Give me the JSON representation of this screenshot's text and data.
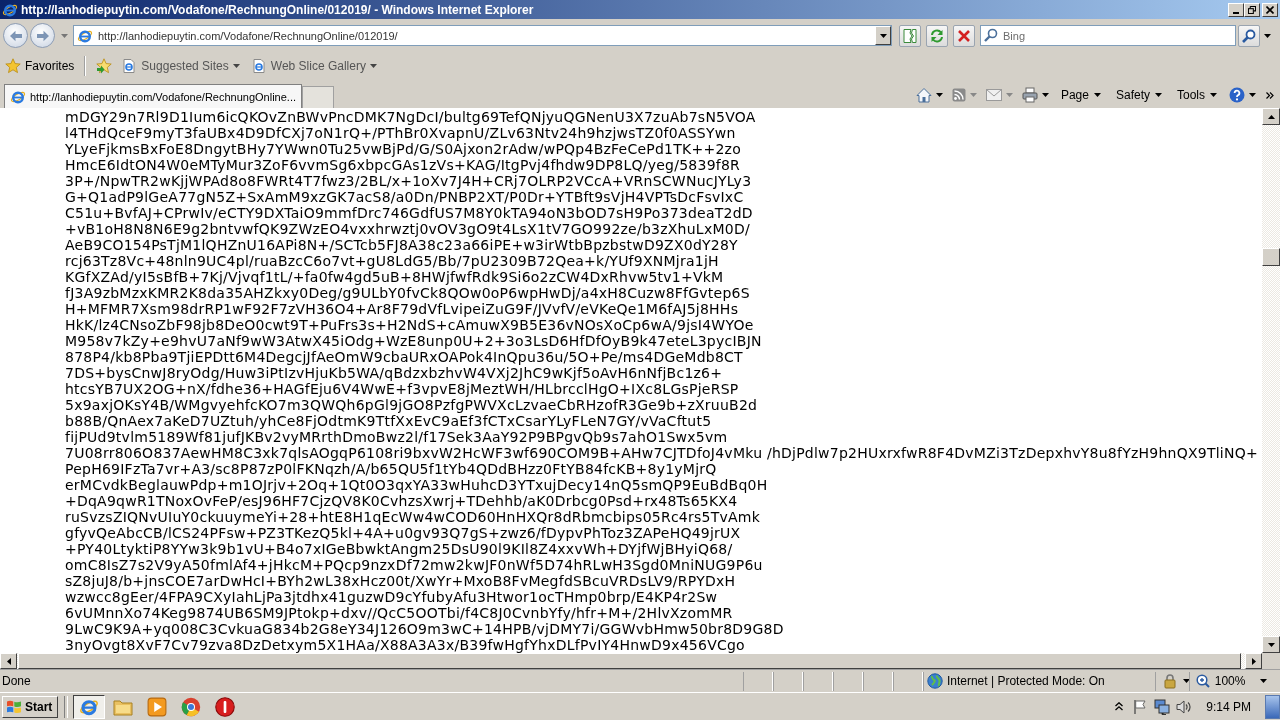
{
  "window": {
    "title": "http://lanhodiepuytin.com/Vodafone/RechnungOnline/012019/ - Windows Internet Explorer"
  },
  "address_bar": {
    "url": "http://lanhodiepuytin.com/Vodafone/RechnungOnline/012019/"
  },
  "search": {
    "placeholder": "Bing"
  },
  "favorites_bar": {
    "label": "Favorites",
    "items": [
      {
        "label": "Suggested Sites"
      },
      {
        "label": "Web Slice Gallery"
      }
    ]
  },
  "tabs": [
    {
      "label": "http://lanhodiepuytin.com/Vodafone/RechnungOnline...",
      "selected": true
    }
  ],
  "command_bar": {
    "menus": [
      {
        "label": "Page"
      },
      {
        "label": "Safety"
      },
      {
        "label": "Tools"
      }
    ]
  },
  "content": {
    "lines": [
      "mDGY29n7Rl9D1Ium6icQKOvZnBWvPncDMK7NgDcI/bultg69TefQNjyuQGNenU3X7zuAb7sN5VOA",
      "l4THdQceF9myT3faUBx4D9DfCXj7oN1rQ+/PThBr0XvapnU/ZLv63Ntv24h9hzjwsTZ0f0ASSYwn",
      "YLyeFjkmsBxFoE8DngytBHy7YWwn0Tu25vwBjPd/G/S0Ajxon2rAdw/wPQp4BzFeCePd1TK++2zo",
      "HmcE6IdtON4W0eMTyMur3ZoF6vvmSg6xbpcGAs1zVs+KAG/ItgPvj4fhdw9DP8LQ/yeg/5839f8R",
      "3P+/NpwTR2wKjjWPAd8o8FWRt4T7fwz3/2BL/x+1oXv7J4H+CRj7OLRP2VCcA+VRnSCWNucJYLy3",
      "G+Q1adP9lGeA77gN5Z+SxAmM9xzGK7acS8/a0Dn/PNBP2XT/P0Dr+YTBft9sVjH4VPTsDcFsvIxC",
      "C51u+BvfAJ+CPrwIv/eCTY9DXTaiO9mmfDrc746GdfUS7M8Y0kTA94oN3bOD7sH9Po373deaT2dD",
      "+vB1oH8N8N6E9g2bntvwfQK9ZWzEO4vxxhrwztj0vOV3gO9t4LsX1tV7GO992ze/b3zXhuLxM0D/",
      "AeB9CO154PsTjM1lQHZnU16APi8N+/SCTcb5FJ8A38c23a66iPE+w3irWtbBpzbstwD9ZX0dY28Y",
      "rcj63Tz8Vc+48nln9UC4pl/ruaBzcC6o7vt+gU8LdG5/Bb/7pU2309B72Qea+k/YUf9XNMjra1jH",
      "KGfXZAd/yI5sBfB+7Kj/Vjvqf1tL/+fa0fw4gd5uB+8HWjfwfRdk9Si6o2zCW4DxRhvw5tv1+VkM",
      "fJ3A9zbMzxKMR2K8da35AHZkxy0Deg/g9ULbY0fvCk8QOw0oP6wpHwDj/a4xH8Cuzw8FfGvtep6S",
      "H+MFMR7Xsm98drRP1wF92F7zVH36O4+Ar8F79dVfLvipeiZuG9F/JVvfV/eVKeQe1M6fAJ5j8HHs",
      "HkK/lz4CNsoZbF98jb8DeO0cwt9T+PuFrs3s+H2NdS+cAmuwX9B5E36vNOsXoCp6wA/9jsI4WYOe",
      "M958v7kZy+e9hvU7aNf9wW3AtwX45iOdg+WzE8unp0U+2+3o3LsD6HfDfOyB9k47eteL3pycIBJN",
      "878P4/kb8Pba9TjiEPDtt6M4DegcjJfAeOmW9cbaURxOAPok4InQpu36u/5O+Pe/ms4DGeMdb8CT",
      "7DS+bysCnwJ8ryOdg/Huw3iPtIzvHjuKb5WA/qBdzxbzhvW4VXj2JhC9wKjf5oAvH6nNfjBc1z6+",
      "htcsYB7UX2OG+nX/fdhe36+HAGfEju6V4WwE+f3vpvE8jMeztWH/HLbrcclHgO+IXc8LGsPjeRSP",
      "5x9axjOKsY4B/WMgvyehfcKO7m3QWQh6pGl9jGO8PzfgPWVXcLzvaeCbRHzofR3Ge9b+zXruuB2d",
      "b88B/QnAex7aKeD7UZtuh/yhCe8FjOdtmK9TtfXxEvC9aEf3fCTxCsarYLyFLeN7GY/vVaCftut5",
      "fijPUd9tvlm5189Wf81jufJKBv2vyMRrthDmoBwz2l/f17Sek3AaY92P9BPgvQb9s7ahO1Swx5vm",
      "7U08rr806O837AewHM8C3xk7qlsAOgqP6108ri9bxvW2HcWF3wf690COM9B+AHw7CJTDfoJ4vMku /hDjPdlw7p2HUxrxfwR8F4DvMZi3TzDepxhvY8u8fYzH9hnQX9TliNQ+",
      "PepH69IFzTa7vr+A3/sc8P87zP0lFKNqzh/A/b65QU5f1tYb4QDdBHzz0FtYB84fcKB+8y1yMjrQ",
      "erMCvdkBeglauwPdp+m1OJrjv+2Oq+1Qt0O3qxYA33wHuhcD3YTxujDecy14nQ5smQP9EuBdBq0H",
      "+DqA9qwR1TNoxOvFeP/esJ96HF7CjzQV8K0CvhzsXwrj+TDehhb/aK0Drbcg0Psd+rx48Ts65KX4",
      "ruSvzsZIQNvUIuY0ckuuymeYi+28+htE8H1qEcWw4wCOD60HnHXQr8dRbmcbips05Rc4rs5TvAmk",
      "gfyvQeAbcCB/lCS24PFsw+PZ3TKezQ5kl+4A+u0gv93Q7gS+zwz6/fDypvPhToz3ZAPeHQ49jrUX",
      "+PY40LtyktiP8YYw3k9b1vU+B4o7xIGeBbwktAngm25DsU90l9KIl8Z4xxvWh+DYjfWjBHyiQ68/",
      "omC8IsZ7s2V9yA50fmlAf4+jHkcM+PQcp9nzxDf72mw2kwJF0nWf5D74hRLwH3Sgd0MniNUG9P6u",
      "sZ8juJ8/b+jnsCOE7arDwHcI+BYh2wL38xHcz00t/XwYr+MxoB8FvMegfdSBcuVRDsLV9/RPYDxH",
      "wzwcc8gEer/4FPA9CXyIahLjPa3jtdhx41guzwD9cYfubyAfu3Htwor1ocTHmp0brp/E4KP4r2Sw",
      "6vUMnnXo74Keg9874UB6SM9JPtokp+dxv//QcC5OOTbi/f4C8J0CvnbYfy/hfr+M+/2HlvXzomMR",
      "9LwC9K9A+yq008C3CvkuaG834b2G8eY34J126O9m3wC+14HPB/vjDMY7i/GGWvbHmw50br8D9G8D",
      "3nyOvgt8XvF7Cv79zva8DzDetxym5X1HAa/X88A3A3x/B39fwHgfYhxDLfPvIY4HnwD9x456VCgo"
    ]
  },
  "status_bar": {
    "text": "Done",
    "zone": "Internet | Protected Mode: On",
    "zoom": "100%"
  },
  "taskbar": {
    "start": "Start",
    "items": [
      {
        "kind": "browser",
        "selected": true
      },
      {
        "kind": "folder",
        "selected": false
      },
      {
        "kind": "player",
        "selected": false
      },
      {
        "kind": "globe",
        "selected": false
      },
      {
        "kind": "alert",
        "selected": false
      }
    ],
    "clock": "9:14 PM"
  }
}
